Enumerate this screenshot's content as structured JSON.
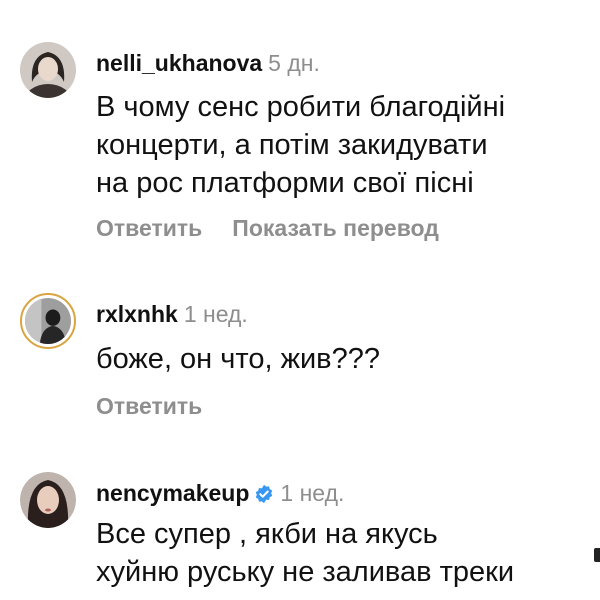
{
  "comments": [
    {
      "username": "nelli_ukhanova",
      "time": "5 дн.",
      "lines": [
        "В чому сенс робити благодійні",
        "концерти, а потім закидувати",
        "на рос платформи свої пісні"
      ],
      "reply_label": "Ответить",
      "translate_label": "Показать перевод",
      "verified": false
    },
    {
      "username": "rxlxnhk",
      "time": "1 нед.",
      "lines": [
        "боже, он что, жив???"
      ],
      "reply_label": "Ответить",
      "verified": false
    },
    {
      "username": "nencymakeup",
      "time": "1 нед.",
      "lines": [
        "Все супер , якби на якусь",
        "хуйню руську не заливав треки"
      ],
      "verified": true
    }
  ],
  "icons": {
    "verified": "verified-badge-icon",
    "verified_color": "#3897f0",
    "story_ring_color": "#d9a441"
  }
}
